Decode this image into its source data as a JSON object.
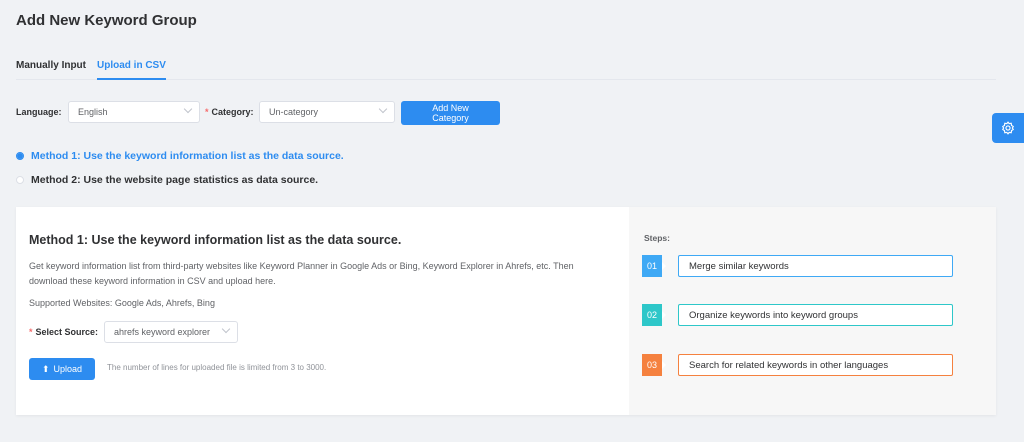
{
  "page": {
    "title": "Add New Keyword Group"
  },
  "tabs": [
    {
      "label": "Manually Input",
      "active": false
    },
    {
      "label": "Upload in CSV",
      "active": true
    }
  ],
  "filters": {
    "language_label": "Language:",
    "language_value": "English",
    "category_required": "*",
    "category_label": "Category:",
    "category_value": "Un-category",
    "add_category_label": "Add New Category"
  },
  "methods": [
    {
      "label": "Method 1: Use the keyword information list as the data source.",
      "selected": true
    },
    {
      "label": "Method 2: Use the website page statistics as data source.",
      "selected": false
    }
  ],
  "card": {
    "title": "Method 1: Use the keyword information list as the data source.",
    "description": "Get keyword information list from third-party websites like Keyword Planner in Google Ads or Bing, Keyword Explorer in Ahrefs, etc. Then download these keyword information in CSV and upload here.",
    "supported_sites": "Supported Websites: Google Ads, Ahrefs, Bing",
    "source_required": "*",
    "source_label": "Select Source:",
    "source_value": "ahrefs keyword explorer",
    "upload_label": "Upload",
    "upload_note": "The number of lines for uploaded file is limited from 3 to 3000."
  },
  "steps": {
    "label": "Steps:",
    "items": [
      {
        "num": "01",
        "text": "Merge similar keywords",
        "color": "#3fa9f5"
      },
      {
        "num": "02",
        "text": "Organize keywords into keyword groups",
        "color": "#2ec7c9"
      },
      {
        "num": "03",
        "text": "Search for related keywords in other languages",
        "color": "#f5813f"
      }
    ]
  },
  "colors": {
    "accent": "#2d8cf0",
    "required": "#f56c6c"
  },
  "icons": {
    "settings": "gear-icon",
    "upload": "upload-icon",
    "dropdown": "chevron-down-icon"
  }
}
